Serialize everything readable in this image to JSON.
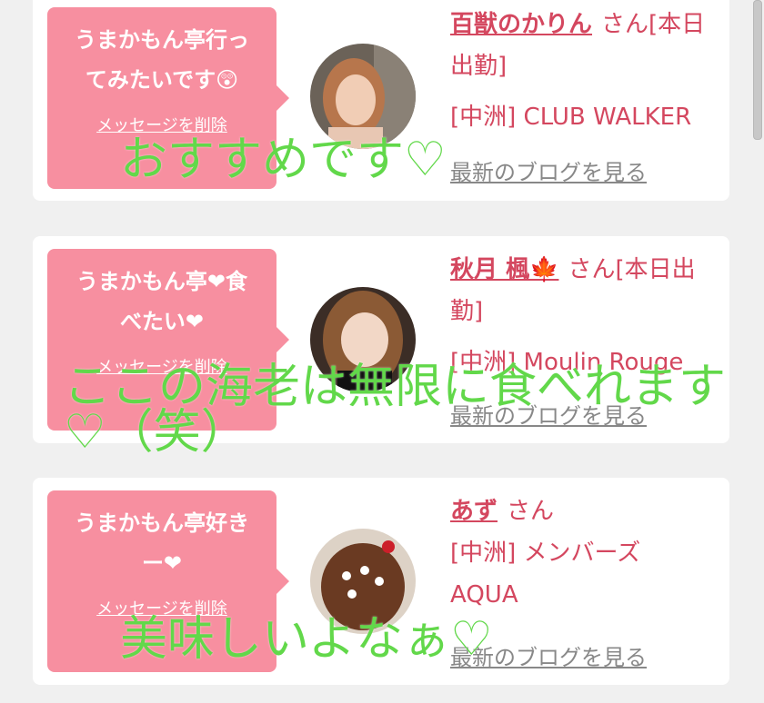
{
  "cards": [
    {
      "message": "うまかもん亭行ってみたいです😲",
      "message_lines": [
        "うまかもん亭行っ",
        "てみたいです😲"
      ],
      "delete_label": "メッセージを削除",
      "name": "百獣のかりん",
      "honorific": "さん[本日出勤]",
      "shop": "[中洲] CLUB WALKER",
      "blog_label": "最新のブログを見る"
    },
    {
      "message_lines": [
        "うまかもん亭❤食",
        "べたい❤"
      ],
      "delete_label": "メッセージを削除",
      "name": "秋月 楓🍁",
      "honorific": "さん[本日出勤]",
      "shop": "[中洲] Moulin Rouge",
      "blog_label": "最新のブログを見る"
    },
    {
      "message_lines": [
        "うまかもん亭好き",
        "ー❤"
      ],
      "delete_label": "メッセージを削除",
      "name": "あず",
      "honorific": "さん",
      "shop": "[中洲] メンバーズAQUA",
      "blog_label": "最新のブログを見る"
    }
  ],
  "overlays": [
    "おすすめです♡",
    "ここの海老は無限に食べれます",
    "♡（笑）",
    "美味しいよなぁ♡"
  ],
  "colors": {
    "bubble": "#f78fa0",
    "accent": "#d4475f",
    "overlay": "#62d84a",
    "background": "#f0f0f0"
  }
}
